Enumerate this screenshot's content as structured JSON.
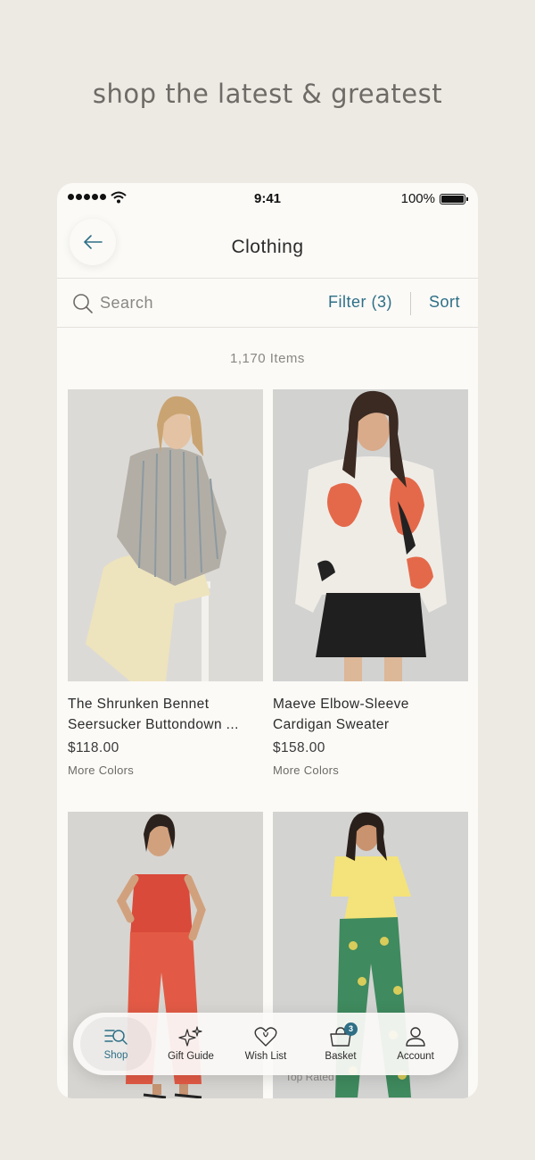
{
  "headline": "shop the latest & greatest",
  "status_bar": {
    "time": "9:41",
    "battery": "100%"
  },
  "nav": {
    "title": "Clothing"
  },
  "search": {
    "placeholder": "Search",
    "filter_label": "Filter (3)",
    "sort_label": "Sort"
  },
  "item_count": "1,170 Items",
  "products": [
    {
      "name_line1": "The Shrunken Bennet",
      "name_line2": "Seersucker Buttondown ...",
      "price": "$118.00",
      "more": "More Colors"
    },
    {
      "name_line1": "Maeve Elbow-Sleeve",
      "name_line2": "Cardigan Sweater",
      "price": "$158.00",
      "more": "More Colors"
    },
    {
      "name_line1": "",
      "name_line2": "",
      "price": "",
      "more": ""
    },
    {
      "name_line1": "",
      "name_line2": "",
      "price": "",
      "more": "",
      "badge": "Top Rated"
    }
  ],
  "tabbar": {
    "tabs": [
      {
        "label": "Shop",
        "icon": "shop-search-icon",
        "active": true
      },
      {
        "label": "Gift Guide",
        "icon": "sparkle-icon"
      },
      {
        "label": "Wish List",
        "icon": "heart-icon"
      },
      {
        "label": "Basket",
        "icon": "basket-icon",
        "badge": "3"
      },
      {
        "label": "Account",
        "icon": "person-icon"
      }
    ]
  },
  "colors": {
    "accent": "#2e6f86",
    "background": "#ede9e3",
    "screen": "#fbfaf7"
  }
}
